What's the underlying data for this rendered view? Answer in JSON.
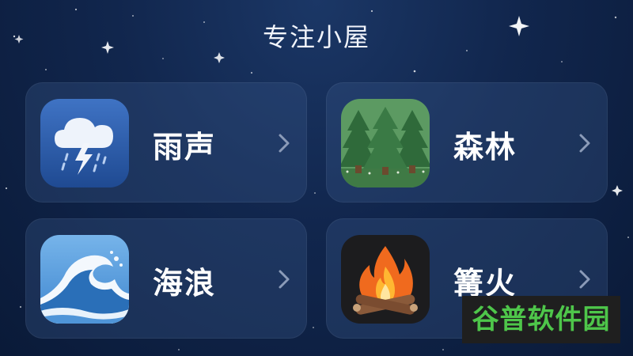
{
  "header": {
    "title": "专注小屋"
  },
  "cards": [
    {
      "label": "雨声",
      "icon": "rain-cloud-icon"
    },
    {
      "label": "森林",
      "icon": "forest-icon"
    },
    {
      "label": "海浪",
      "icon": "wave-icon"
    },
    {
      "label": "篝火",
      "icon": "campfire-icon"
    }
  ],
  "watermark": {
    "text": "谷普软件园"
  },
  "colors": {
    "background": "#11264d",
    "card": "#2a4470",
    "rain_icon_bg": "#2c5aa8",
    "forest_icon_bg": "#4e8a56",
    "wave_icon_bg": "#5b9fdc",
    "campfire_icon_bg": "#1c1c1e",
    "watermark_text": "#4ec64a"
  }
}
